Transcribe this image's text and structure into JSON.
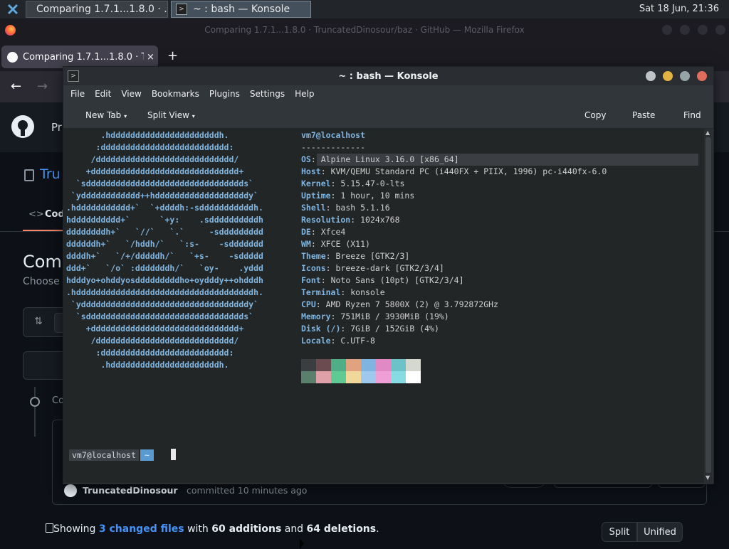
{
  "panel": {
    "firefox_task": "Comparing 1.7.1...1.8.0 · ...",
    "terminal_task": "~ : bash — Konsole",
    "clock": "Sat 18 Jun, 21:36"
  },
  "firefox": {
    "window_title": "Comparing 1.7.1...1.8.0 · TruncatedDinosour/baz · GitHub — Mozilla Firefox",
    "tab_title": "Comparing 1.7.1...1.8.0 · Tr",
    "new_tab": "+",
    "close_tab": "×"
  },
  "github": {
    "nav_partial": "Pr",
    "repo_partial": "Tru",
    "code_tab_partial": "Cod",
    "compare_heading_partial": "Comp",
    "choose_partial": "Choose t",
    "commit_partial": "Co",
    "author": "TruncatedDinosour",
    "committed": "committed 10 minutes ago",
    "showing": "Showing",
    "changed_files": "3 changed files",
    "with": "with",
    "additions": "60 additions",
    "and": "and",
    "deletions": "64 deletions",
    "period": ".",
    "split": "Split",
    "unified": "Unified"
  },
  "konsole": {
    "title": "~ : bash — Konsole",
    "menu": [
      "File",
      "Edit",
      "View",
      "Bookmarks",
      "Plugins",
      "Settings",
      "Help"
    ],
    "toolbar": {
      "new_tab": "New Tab",
      "split_view": "Split View",
      "copy": "Copy",
      "paste": "Paste",
      "find": "Find"
    }
  },
  "terminal": {
    "ascii": [
      "       .hddddddddddddddddddddddh.",
      "      :dddddddddddddddddddddddddd:",
      "     /dddddddddddddddddddddddddddd/",
      "    +dddddddddddddddddddddddddddddd+",
      "  `sdddddddddddddddddddddddddddddddds`",
      " `ydddddddddddd++hdddddddddddddddddddy`",
      ".hddddddddddd+`  `+ddddh:-sdddddddddddh.",
      "hdddddddddd+`      `+y:    .sddddddddddh",
      "ddddddddh+`   `//`   `.`     -sddddddddd",
      "ddddddh+`   `/hddh/`   `:s-    -sddddddd",
      "ddddh+`   `/+/dddddh/`   `+s-    -sddddd",
      "ddd+`   `/o` :dddddddh/`   `oy-    .yddd",
      "hdddyo+ohddyosdddddddddho+oydddy++ohdddh",
      ".hddddddddddddddddddddddddddddddddddddh.",
      " `yddddddddddddddddddddddddddddddddddy`",
      "  `sdddddddddddddddddddddddddddddddds`",
      "    +dddddddddddddddddddddddddddddd+",
      "     /dddddddddddddddddddddddddddd/",
      "      :dddddddddddddddddddddddddd:",
      "       .hddddddddddddddddddddddh."
    ],
    "header": "vm7@localhost",
    "separator": "-------------",
    "info": [
      {
        "key": "OS",
        "value": "Alpine Linux 3.16.0 [x86_64]"
      },
      {
        "key": "Host",
        "value": "KVM/QEMU Standard PC (i440FX + PIIX, 1996) pc-i440fx-6.0"
      },
      {
        "key": "Kernel",
        "value": "5.15.47-0-lts"
      },
      {
        "key": "Uptime",
        "value": "1 hour, 10 mins"
      },
      {
        "key": "Shell",
        "value": "bash 5.1.16"
      },
      {
        "key": "Resolution",
        "value": "1024x768"
      },
      {
        "key": "DE",
        "value": "Xfce4"
      },
      {
        "key": "WM",
        "value": "XFCE (X11)"
      },
      {
        "key": "Theme",
        "value": "Breeze [GTK2/3]"
      },
      {
        "key": "Icons",
        "value": "breeze-dark [GTK2/3/4]"
      },
      {
        "key": "Font",
        "value": "Noto Sans (10pt) [GTK2/3/4]"
      },
      {
        "key": "Terminal",
        "value": "konsole"
      },
      {
        "key": "CPU",
        "value": "AMD Ryzen 7 5800X (2) @ 3.792872GHz"
      },
      {
        "key": "Memory",
        "value": "751MiB / 3930MiB (19%)"
      },
      {
        "key": "Disk (/)",
        "value": "7GiB / 152GiB (4%)"
      },
      {
        "key": "Locale",
        "value": "C.UTF-8"
      }
    ],
    "palette_top": [
      "#3b3e40",
      "#6b4b4f",
      "#4fae86",
      "#e0a37e",
      "#7fb3e0",
      "#e089c4",
      "#6cc2c9",
      "#d5d8cf"
    ],
    "palette_bottom": [
      "#5a7f6c",
      "#e0a0a8",
      "#5fca93",
      "#f0d79a",
      "#9fc8ee",
      "#ef9fd6",
      "#87dbe2",
      "#ffffff"
    ],
    "prompt_user": "vm7@localhost",
    "prompt_dir": "~"
  }
}
